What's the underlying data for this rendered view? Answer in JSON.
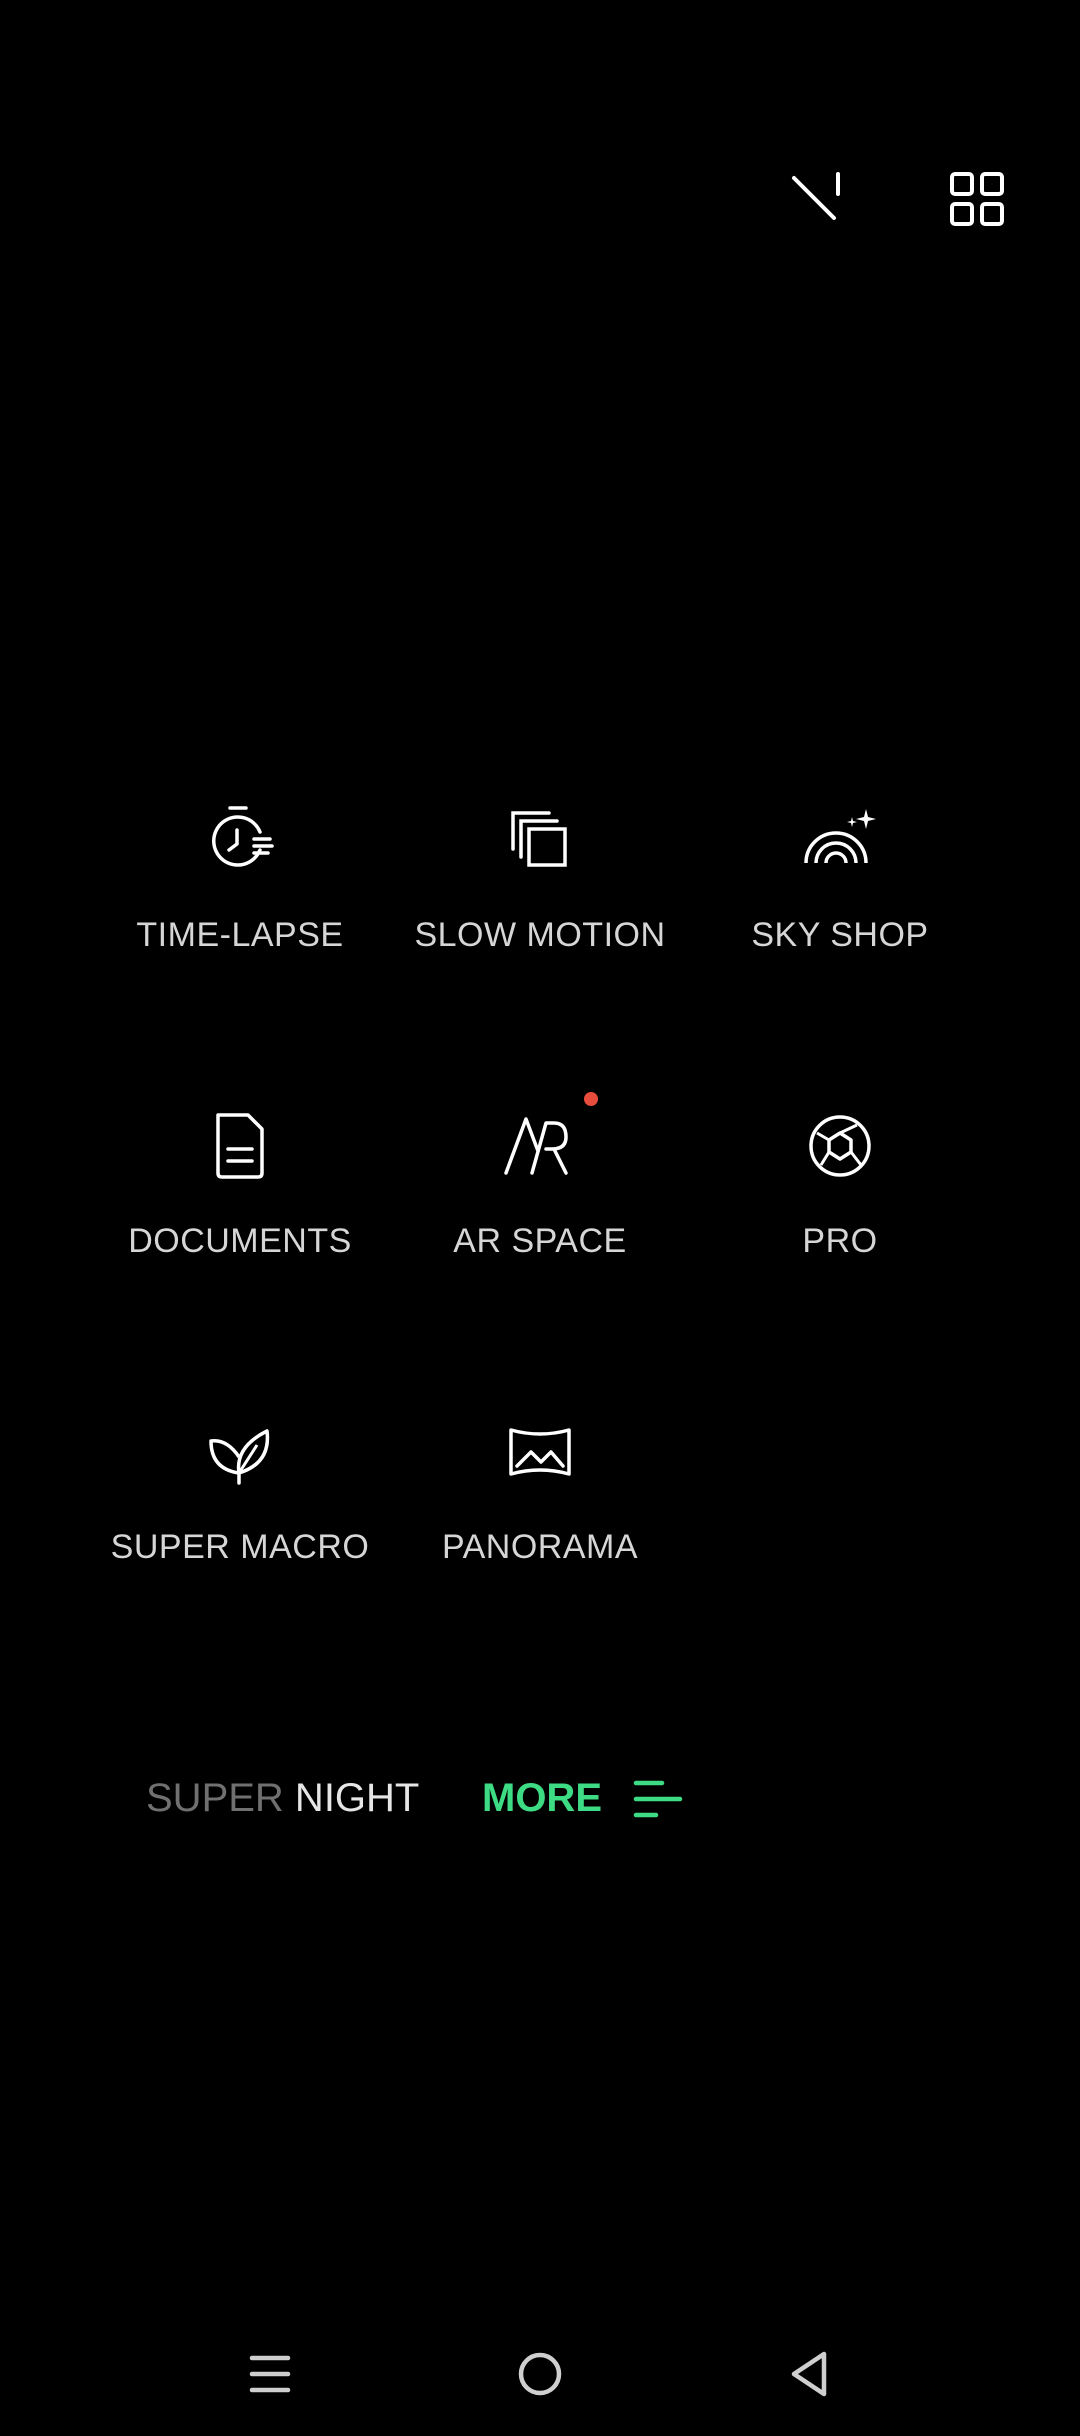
{
  "top_bar": {
    "flash_icon": "magic-wand-icon",
    "grid_icon": "grid-icon"
  },
  "modes": [
    {
      "label": "TIME-LAPSE",
      "icon": "timer-icon"
    },
    {
      "label": "SLOW MOTION",
      "icon": "stacked-frames-icon"
    },
    {
      "label": "SKY SHOP",
      "icon": "rainbow-sparkle-icon"
    },
    {
      "label": "DOCUMENTS",
      "icon": "document-icon"
    },
    {
      "label": "AR SPACE",
      "icon": "ar-icon",
      "badge_color": "#e74c3c"
    },
    {
      "label": "PRO",
      "icon": "aperture-icon"
    },
    {
      "label": "SUPER MACRO",
      "icon": "leaf-icon"
    },
    {
      "label": "PANORAMA",
      "icon": "panorama-icon"
    }
  ],
  "mode_bar": {
    "super_dim": "SUPER",
    "night": " NIGHT",
    "more": "MORE",
    "accent_color": "#3ddc84"
  },
  "nav": {
    "menu_icon": "menu-icon",
    "home_icon": "home-icon",
    "back_icon": "back-icon"
  }
}
